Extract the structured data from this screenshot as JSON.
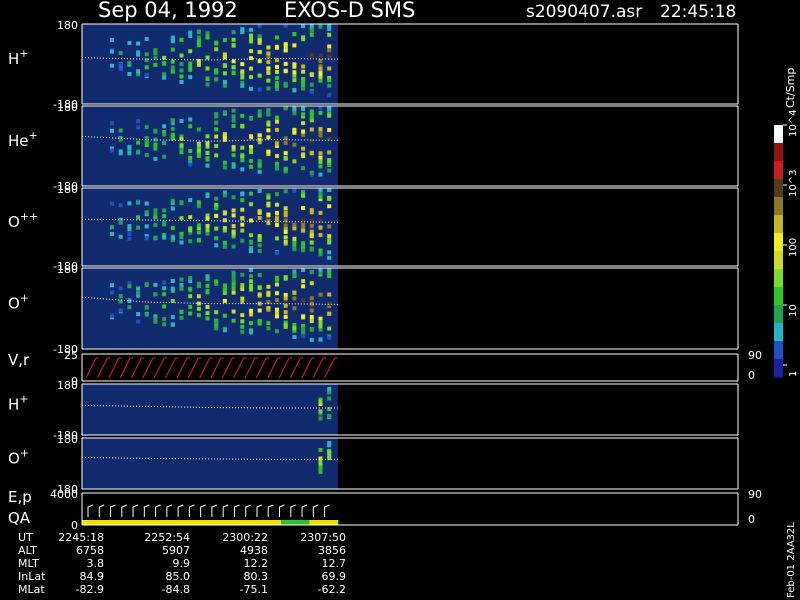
{
  "header": {
    "date": "Sep 04, 1992",
    "instrument": "EXOS-D SMS",
    "file": "s2090407.asr",
    "time": "22:45:18"
  },
  "colorbar": {
    "unit_label": "Ct/Smp",
    "ticks": [
      "1",
      "10",
      "100",
      "10^3",
      "10^4"
    ],
    "colors": [
      "#1e1ea0",
      "#1e50c8",
      "#28b4c8",
      "#28a050",
      "#28c828",
      "#78dc28",
      "#c8dc28",
      "#f0f028",
      "#c8b428",
      "#8c7828",
      "#503c1e",
      "#c81e1e",
      "#8c1414",
      "#ffffff"
    ]
  },
  "footer": {
    "side_label": "Feb-01 2AA32L"
  },
  "colors": {
    "panel_bg": "#102a6e",
    "data_text": "#ffffff",
    "velocity_vectors": "#e02020",
    "qa_segments": [
      "#f0e000",
      "#f0e000",
      "#f0e000",
      "#f0e000",
      "#f0e000",
      "#f0e000",
      "#f0e000",
      "#30c030",
      "#f0e000"
    ]
  },
  "chart_data": {
    "type": "heatmap",
    "panels": [
      {
        "id": "h-plus",
        "label": "H",
        "superscript": "+",
        "yticks": [
          "180",
          "-180"
        ],
        "kind": "pitch_spectrogram",
        "trace_y": [
          0.42,
          0.44,
          0.45,
          0.43,
          0.44
        ]
      },
      {
        "id": "he-plus",
        "label": "He",
        "superscript": "+",
        "yticks": [
          "180",
          "-180"
        ],
        "kind": "pitch_spectrogram",
        "trace_y": [
          0.38,
          0.42,
          0.44,
          0.42,
          0.43
        ]
      },
      {
        "id": "o-plus-plus",
        "label": "O",
        "superscript": "++",
        "yticks": [
          "180",
          "-180"
        ],
        "kind": "pitch_spectrogram",
        "trace_y": [
          0.4,
          0.41,
          0.42,
          0.43,
          0.44
        ]
      },
      {
        "id": "o-plus",
        "label": "O",
        "superscript": "+",
        "yticks": [
          "180",
          "-180"
        ],
        "kind": "pitch_spectrogram",
        "trace_y": [
          0.36,
          0.42,
          0.44,
          0.44,
          0.45
        ]
      },
      {
        "id": "v-r",
        "label": "V,r",
        "superscript": "",
        "yticks": [
          "25",
          "0"
        ],
        "right_ticks": [
          "90",
          "0"
        ],
        "kind": "vectors"
      },
      {
        "id": "h-plus-2",
        "label": "H",
        "superscript": "+",
        "yticks": [
          "180",
          "-180"
        ],
        "kind": "pitch_spectrogram_weak",
        "trace_y": [
          0.42,
          0.44,
          0.46,
          0.47,
          0.47
        ]
      },
      {
        "id": "o-plus-2",
        "label": "O",
        "superscript": "+",
        "yticks": [
          "180",
          "-180"
        ],
        "kind": "pitch_spectrogram_weak",
        "trace_y": [
          0.38,
          0.4,
          0.41,
          0.42,
          0.42
        ]
      },
      {
        "id": "e-p-qa",
        "label": "E,p",
        "label2": "QA",
        "superscript": "",
        "yticks": [
          "4000",
          "0"
        ],
        "right_ticks": [
          "90",
          "0"
        ],
        "kind": "energy_qa"
      }
    ],
    "data_extent_fraction": 0.39,
    "time_axis": {
      "row_labels": [
        "UT",
        "ALT",
        "MLT",
        "InLat",
        "MLat"
      ],
      "columns": [
        {
          "UT": "2245:18",
          "ALT": "6758",
          "MLT": "3.8",
          "InLat": "84.9",
          "MLat": "-82.9"
        },
        {
          "UT": "2252:54",
          "ALT": "5907",
          "MLT": "9.9",
          "InLat": "85.0",
          "MLat": "-84.8"
        },
        {
          "UT": "2300:22",
          "ALT": "4938",
          "MLT": "12.2",
          "InLat": "80.3",
          "MLat": "-75.1"
        },
        {
          "UT": "2307:50",
          "ALT": "3856",
          "MLT": "12.7",
          "InLat": "69.9",
          "MLat": "-62.2"
        }
      ]
    }
  }
}
